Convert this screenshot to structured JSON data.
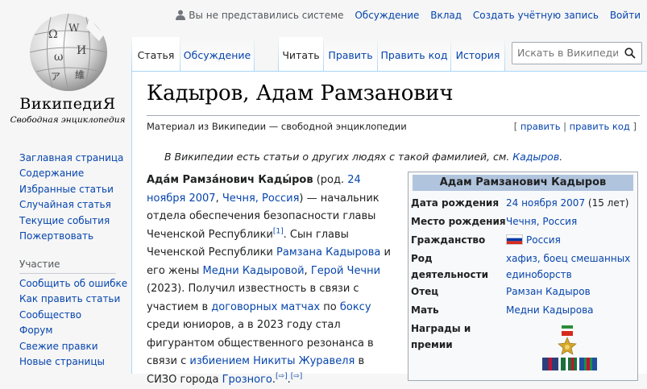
{
  "logo": {
    "wordmark": "ВикипедиЯ",
    "tagline": "Свободная энциклопедия",
    "globe_glyphs": [
      "Ω",
      "W",
      "И",
      "ω",
      "ア",
      "維"
    ]
  },
  "personal": {
    "not_logged_in": "Вы не представились системе",
    "talk": "Обсуждение",
    "contributions": "Вклад",
    "create_account": "Создать учётную запись",
    "login": "Войти"
  },
  "tabs": {
    "article": "Статья",
    "discussion": "Обсуждение",
    "read": "Читать",
    "edit": "Править",
    "edit_source": "Править код",
    "history": "История"
  },
  "search": {
    "placeholder": "Искать в Википедии"
  },
  "sidebar": {
    "main": [
      "Заглавная страница",
      "Содержание",
      "Избранные статьи",
      "Случайная статья",
      "Текущие события",
      "Пожертвовать"
    ],
    "tools_heading": "Участие",
    "tools": [
      "Сообщить об ошибке",
      "Как править статьи",
      "Сообщество",
      "Форум",
      "Свежие правки",
      "Новые страницы"
    ]
  },
  "article": {
    "title": "Кадыров, Адам Рамзанович",
    "from": "Материал из Википедии — свободной энциклопедии",
    "edit_links": {
      "open": "[ ",
      "edit": "править",
      "sep": " | ",
      "edit_source": "править код",
      "close": " ]"
    },
    "hatnote": {
      "text": "В Википедии есть статьи о других людях с такой фамилией, см. ",
      "link": "Кадыров",
      "end": "."
    },
    "body": {
      "name": "Ада́м Рамза́нович Кады́ров",
      "t1": " (род. ",
      "birth_date": "24 ноября 2007",
      "t2": ", ",
      "place": "Чечня, Россия",
      "t3": ") — начальник отдела обеспечения безопасности главы Чеченской Республики",
      "ref1": "[1]",
      "t4": ". Сын главы Чеченской Республики ",
      "father": "Рамзана Кадырова",
      "t5": " и его жены ",
      "mother": "Медни Кадыровой",
      "t6": ", ",
      "hero": "Герой Чечни",
      "t7": " (2023). Получил известность в связи с участием в ",
      "contract": "договорных матчах",
      "t8": " по ",
      "boxing": "боксу",
      "t9": " среди юниоров, а в 2023 году стал фигурантом общественного резонанса в связи с ",
      "beating": "избиением Никиты Журавеля",
      "t10": " в СИЗО города ",
      "grozny": "Грозного",
      "t11": ".",
      "ref2": "[⇨]",
      "t12": ".",
      "ref3": "[⇨]"
    }
  },
  "infobox": {
    "title": "Адам Рамзанович Кадыров",
    "birth_label": "Дата рождения",
    "birth_value": "24 ноября 2007",
    "birth_age": " (15 лет)",
    "place_label": "Место рождения",
    "place_value": "Чечня, Россия",
    "citizenship_label": "Гражданство",
    "citizenship_value": "Россия",
    "occupation_label": "Род деятельности",
    "occupation_value": "хафиз, боец смешанных единоборств",
    "father_label": "Отец",
    "father_value": "Рамзан Кадыров",
    "mother_label": "Мать",
    "mother_value": "Медни Кадырова",
    "awards_label": "Награды и премии"
  },
  "colors": {
    "link": "#0645ad",
    "infobox_header": "#b0c4de",
    "tab_border": "#a7d7f9"
  }
}
